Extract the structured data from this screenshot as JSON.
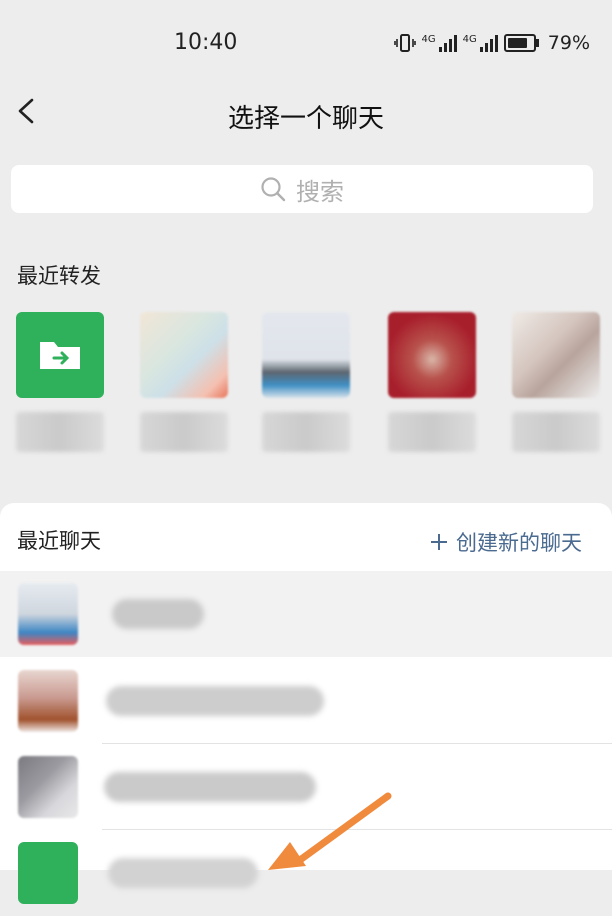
{
  "status_bar": {
    "time": "10:40",
    "battery": "79%",
    "network1": "4G",
    "network2": "4G"
  },
  "nav": {
    "title": "选择一个聊天"
  },
  "search": {
    "placeholder": "搜索"
  },
  "recent_forward": {
    "title": "最近转发",
    "items": [
      {
        "label": "",
        "avatar": "green-folder"
      },
      {
        "label": "",
        "avatar": "blurred"
      },
      {
        "label": "",
        "avatar": "blurred"
      },
      {
        "label": "",
        "avatar": "blurred-red"
      },
      {
        "label": "",
        "avatar": "blurred"
      }
    ]
  },
  "recent_chats": {
    "title": "最近聊天",
    "create_label": "创建新的聊天",
    "items": [
      {
        "name": "",
        "highlighted": true
      },
      {
        "name": "",
        "highlighted": false
      },
      {
        "name": "",
        "highlighted": false
      },
      {
        "name": "",
        "highlighted": false
      }
    ]
  },
  "colors": {
    "accent_green": "#2fb05a",
    "link_blue": "#4a6a90",
    "annotation_arrow": "#f08a3c"
  }
}
